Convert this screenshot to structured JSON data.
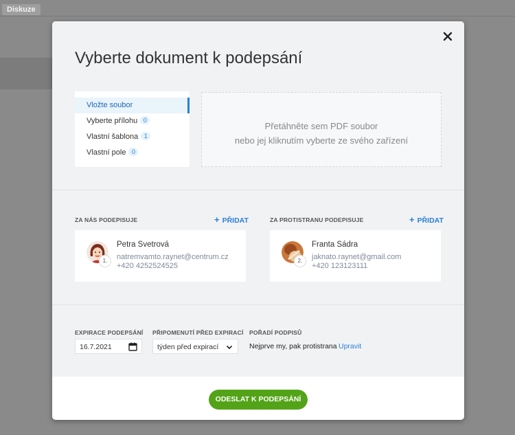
{
  "background": {
    "tab_label": "Diskuze"
  },
  "modal": {
    "title": "Vyberte dokument k podepsání",
    "tabs": [
      {
        "label": "Vložte soubor",
        "count": "",
        "active": true
      },
      {
        "label": "Vyberte přílohu",
        "count": "0",
        "active": false
      },
      {
        "label": "Vlastní šablona",
        "count": "1",
        "active": false
      },
      {
        "label": "Vlastní pole",
        "count": "0",
        "active": false
      }
    ],
    "dropzone": {
      "line1": "Přetáhněte sem PDF soubor",
      "line2": "nebo jej kliknutím vyberte ze svého zařízení"
    },
    "our_side": {
      "label": "ZA NÁS PODEPISUJE",
      "add_label": "PŘIDAT",
      "signer": {
        "order": "1.",
        "name": "Petra Svetrová",
        "email": "natremvamto.raynet@centrum.cz",
        "phone": "+420 4252524525"
      }
    },
    "counter_side": {
      "label": "ZA PROTISTRANU PODEPISUJE",
      "add_label": "PŘIDAT",
      "signer": {
        "order": "2.",
        "name": "Franta Sádra",
        "email": "jaknato.raynet@gmail.com",
        "phone": "+420 123123111"
      }
    },
    "expiration": {
      "label": "EXPIRACE PODEPSÁNÍ",
      "value": "16.7.2021"
    },
    "reminder": {
      "label": "PŘIPOMENUTÍ PŘED EXPIRACÍ",
      "value": "týden před expirací"
    },
    "signing_order": {
      "label": "POŘADÍ PODPISŮ",
      "value": "Nejprve my, pak protistrana",
      "edit_label": "Upravit"
    },
    "submit_label": "ODESLAT K PODEPSÁNÍ"
  },
  "colors": {
    "accent": "#2a7fd6",
    "submit": "#53a318"
  },
  "icons": [
    "close-icon",
    "plus-icon",
    "calendar-icon",
    "chevron-down-icon"
  ]
}
